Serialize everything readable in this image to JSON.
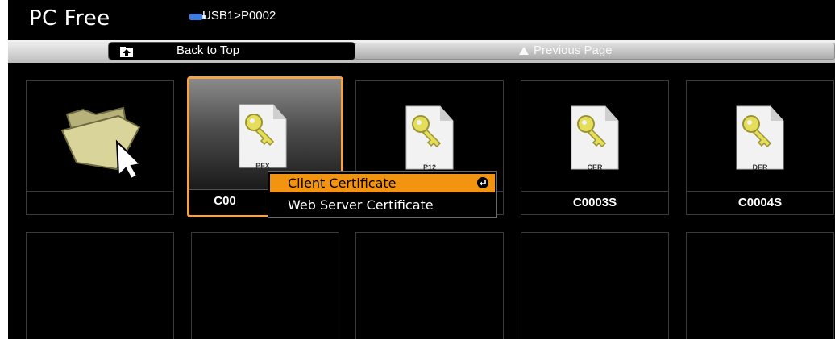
{
  "header": {
    "title": "PC Free",
    "path": "USB1>P0002"
  },
  "toolbar": {
    "back_label": "Back to Top",
    "prev_label": "Previous Page"
  },
  "tiles": [
    {
      "name": "",
      "type": "folder-up"
    },
    {
      "name": "C00",
      "type": "PFX",
      "selected": true
    },
    {
      "name": "",
      "type": "P12"
    },
    {
      "name": "C0003S",
      "type": "CER"
    },
    {
      "name": "C0004S",
      "type": "DER"
    }
  ],
  "context_menu": {
    "items": [
      "Client Certificate",
      "Web Server Certificate"
    ],
    "selected_index": 0
  },
  "colors": {
    "accent": "#f2940f",
    "toolbar": "#d6d6d6",
    "background": "#000000"
  },
  "icons": [
    "usb-icon",
    "back-to-top-icon",
    "up-arrow-icon",
    "folder-up-icon",
    "key-document-icon",
    "enter-icon"
  ]
}
